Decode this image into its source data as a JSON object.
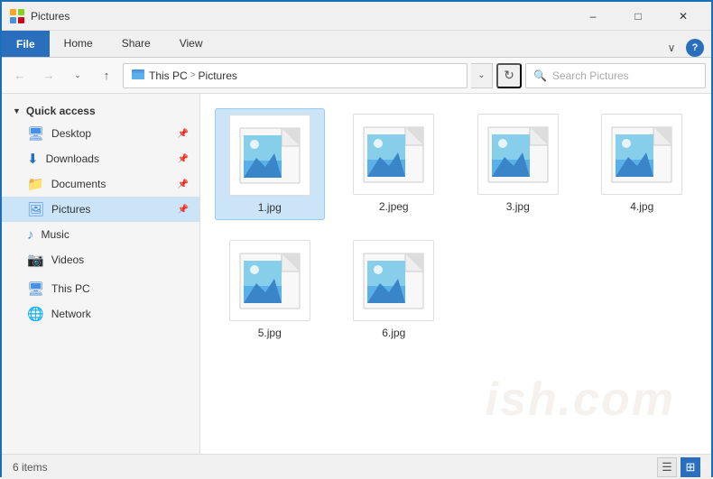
{
  "titlebar": {
    "title": "Pictures",
    "minimize_label": "–",
    "maximize_label": "□",
    "close_label": "✕"
  },
  "ribbon": {
    "tabs": [
      "File",
      "Home",
      "Share",
      "View"
    ],
    "active_tab": "File",
    "chevron_label": "∨",
    "help_label": "?"
  },
  "addressbar": {
    "back_label": "←",
    "forward_label": "→",
    "dropdown_label": "∨",
    "up_label": "↑",
    "path": [
      "This PC",
      "Pictures"
    ],
    "path_separator": ">",
    "dropdown_arrow": "∨",
    "refresh_label": "⟳",
    "search_placeholder": "Search Pictures"
  },
  "sidebar": {
    "quick_access_label": "Quick access",
    "quick_access_chevron": "▶",
    "items": [
      {
        "name": "desktop",
        "label": "Desktop",
        "icon": "🖥",
        "pinned": true
      },
      {
        "name": "downloads",
        "label": "Downloads",
        "icon": "⬇",
        "pinned": true
      },
      {
        "name": "documents",
        "label": "Documents",
        "icon": "📁",
        "pinned": true
      },
      {
        "name": "pictures",
        "label": "Pictures",
        "icon": "🖼",
        "pinned": true,
        "active": true
      },
      {
        "name": "music",
        "label": "Music",
        "icon": "♪",
        "pinned": false
      },
      {
        "name": "videos",
        "label": "Videos",
        "icon": "📷",
        "pinned": false
      }
    ],
    "thispc_label": "This PC",
    "network_label": "Network"
  },
  "files": [
    {
      "name": "1.jpg",
      "selected": true
    },
    {
      "name": "2.jpeg",
      "selected": false
    },
    {
      "name": "3.jpg",
      "selected": false
    },
    {
      "name": "4.jpg",
      "selected": false
    },
    {
      "name": "5.jpg",
      "selected": false
    },
    {
      "name": "6.jpg",
      "selected": false
    }
  ],
  "statusbar": {
    "count_label": "6 items",
    "view_icons": [
      "≡",
      "⊞"
    ],
    "active_view": 1
  },
  "watermark": "ish.com"
}
